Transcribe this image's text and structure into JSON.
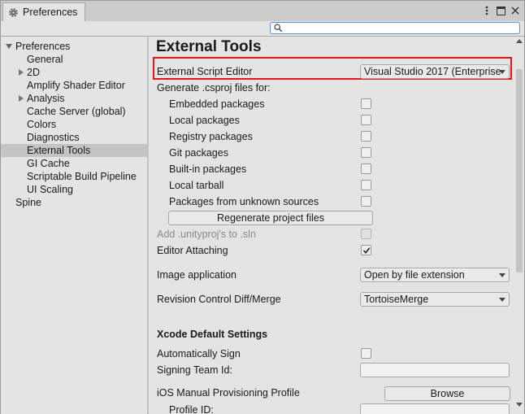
{
  "window": {
    "title": "Preferences"
  },
  "search": {
    "placeholder": ""
  },
  "sidebar": {
    "root": "Preferences",
    "items": [
      {
        "label": "General",
        "expandable": false
      },
      {
        "label": "2D",
        "expandable": true
      },
      {
        "label": "Amplify Shader Editor",
        "expandable": false
      },
      {
        "label": "Analysis",
        "expandable": true
      },
      {
        "label": "Cache Server (global)",
        "expandable": false
      },
      {
        "label": "Colors",
        "expandable": false
      },
      {
        "label": "Diagnostics",
        "expandable": false
      },
      {
        "label": "External Tools",
        "expandable": false,
        "selected": true
      },
      {
        "label": "GI Cache",
        "expandable": false
      },
      {
        "label": "Scriptable Build Pipeline",
        "expandable": false
      },
      {
        "label": "UI Scaling",
        "expandable": false
      }
    ],
    "spine": "Spine"
  },
  "main": {
    "heading": "External Tools",
    "script_editor": {
      "label": "External Script Editor",
      "value": "Visual Studio 2017 (Enterprise)"
    },
    "csproj_header": "Generate .csproj files for:",
    "csproj_options": [
      {
        "label": "Embedded packages",
        "checked": false
      },
      {
        "label": "Local packages",
        "checked": false
      },
      {
        "label": "Registry packages",
        "checked": false
      },
      {
        "label": "Git packages",
        "checked": false
      },
      {
        "label": "Built-in packages",
        "checked": false
      },
      {
        "label": "Local tarball",
        "checked": false
      },
      {
        "label": "Packages from unknown sources",
        "checked": false
      }
    ],
    "regenerate_label": "Regenerate project files",
    "add_unityproj": {
      "label": "Add .unityproj's to .sln",
      "checked": false
    },
    "editor_attaching": {
      "label": "Editor Attaching",
      "checked": true
    },
    "image_application": {
      "label": "Image application",
      "value": "Open by file extension"
    },
    "revision_control": {
      "label": "Revision Control Diff/Merge",
      "value": "TortoiseMerge"
    },
    "xcode_header": "Xcode Default Settings",
    "auto_sign": {
      "label": "Automatically Sign",
      "checked": false
    },
    "signing_team": {
      "label": "Signing Team Id:",
      "value": ""
    },
    "ios_profile": {
      "label": "iOS Manual Provisioning Profile",
      "browse_label": "Browse"
    },
    "profile_id": {
      "label": "Profile ID:"
    }
  },
  "colors": {
    "highlight": "#e5141d",
    "selected_row": "#c4c4c4",
    "panel": "#e4e4e4",
    "search_focus": "#5a8ed8"
  }
}
